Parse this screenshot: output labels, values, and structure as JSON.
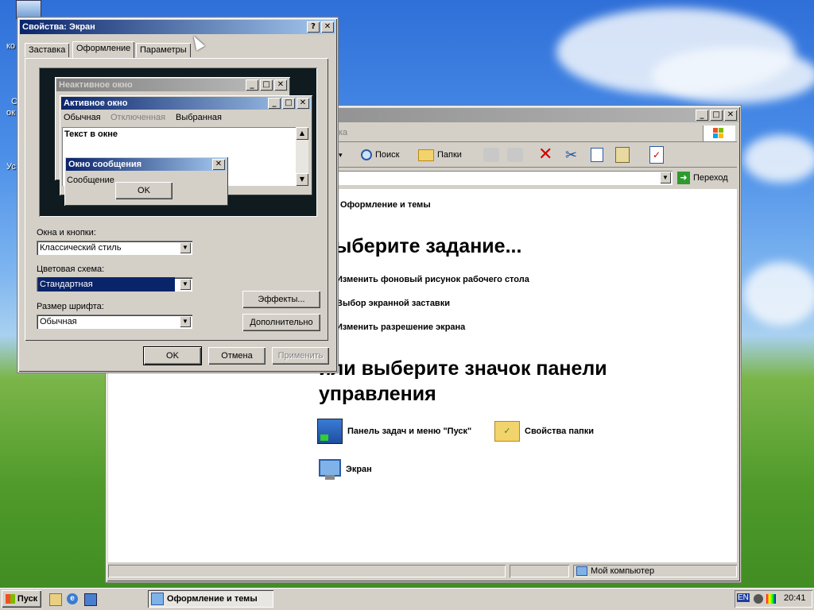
{
  "desktop": {
    "icon_labels": [
      "ко",
      "С",
      "ок",
      "Ус"
    ]
  },
  "display_props": {
    "title": "Свойства: Экран",
    "title_buttons": {
      "help": "?",
      "close": "✕"
    },
    "tabs": [
      {
        "label": "Заставка"
      },
      {
        "label": "Оформление"
      },
      {
        "label": "Параметры"
      }
    ],
    "preview": {
      "inactive_title": "Неактивное окно",
      "active_title": "Активное окно",
      "menu_normal": "Обычная",
      "menu_disabled": "Отключенная",
      "menu_selected": "Выбранная",
      "window_text": "Текст в окне",
      "msgbox_title": "Окно сообщения",
      "msgbox_text": "Сообщение",
      "msgbox_ok": "OK"
    },
    "windows_buttons_label": "Окна и кнопки:",
    "windows_buttons_value": "Классический стиль",
    "color_scheme_label": "Цветовая схема:",
    "color_scheme_value": "Стандартная",
    "font_size_label": "Размер шрифта:",
    "font_size_value": "Обычная",
    "effects_button": "Эффекты...",
    "advanced_button": "Дополнительно",
    "ok_button": "OK",
    "cancel_button": "Отмена",
    "apply_button": "Применить"
  },
  "explorer": {
    "menu_partial": "ка",
    "toolbar": {
      "search": "Поиск",
      "folders": "Папки"
    },
    "go_button": "Переход",
    "breadcrumb_title": "Оформление и темы",
    "pick_task_heading": "ыберите задание...",
    "tasks": [
      "Изменить фоновый рисунок рабочего стола",
      "Выбор экранной заставки",
      "Изменить разрешение экрана"
    ],
    "pick_icon_heading_line1": "или выберите значок панели",
    "pick_icon_heading_line2": "управления",
    "icons": [
      {
        "label": "Панель задач и меню \"Пуск\""
      },
      {
        "label": "Свойства папки"
      },
      {
        "label": "Экран"
      }
    ],
    "status_right": "Мой компьютер"
  },
  "taskbar": {
    "start_label": "Пуск",
    "task_button": "Оформление и темы",
    "lang": "EN",
    "clock": "20:41"
  },
  "colors": {
    "active_title_start": "#0a246a",
    "active_title_end": "#a6caf0",
    "face": "#d4d0c8"
  }
}
